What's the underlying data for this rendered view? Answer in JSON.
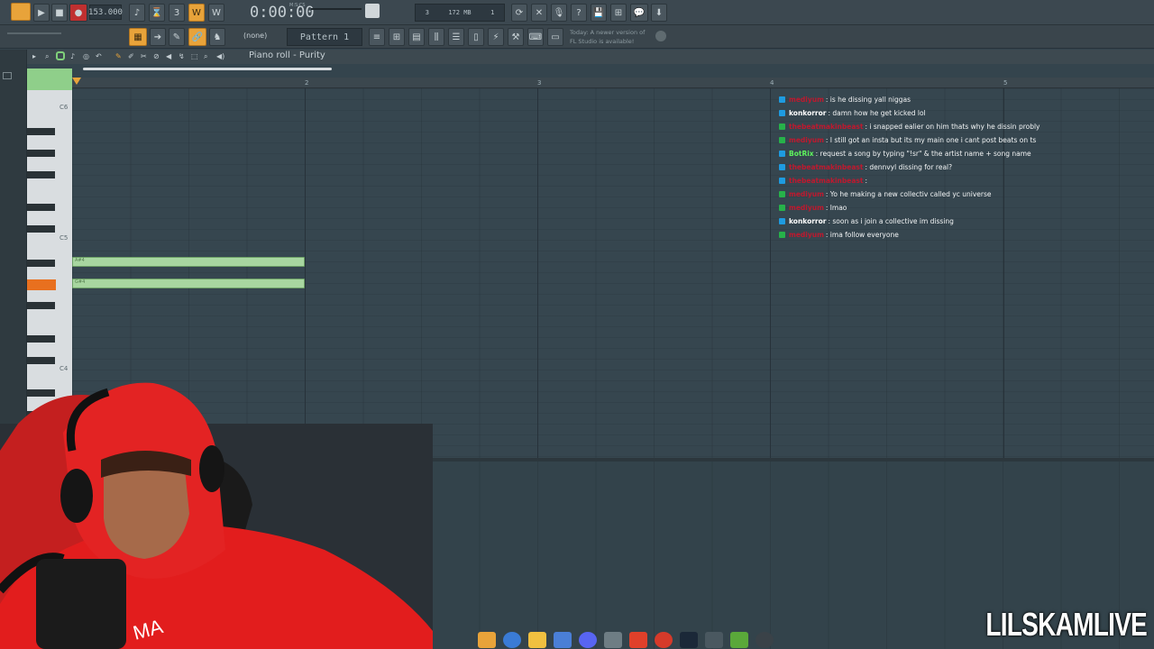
{
  "toolbar": {
    "tempo": "153.000",
    "time_display": "0:00:00",
    "time_mode": "M:S:CS",
    "cpu_bar": "3",
    "memory": "172 MB",
    "voices": "1",
    "pattern_selector": "(none)",
    "pattern_name": "Pattern 1",
    "news_line1": "Today: A newer version of",
    "news_line2": "FL Studio is available!"
  },
  "piano_roll": {
    "title": "Piano roll - Purity",
    "bar_numbers": [
      "2",
      "3",
      "4",
      "5"
    ],
    "octave_labels": [
      "C6",
      "C5",
      "C4"
    ],
    "notes": [
      {
        "label": "A#4"
      },
      {
        "label": "G#4"
      }
    ]
  },
  "chat": {
    "messages": [
      {
        "user": "mediyum",
        "user_color": "#c0182e",
        "text": ": is he dissing yall niggas",
        "badge": "blue"
      },
      {
        "user": "konkorror",
        "user_color": "#ffffff",
        "text": ": damn how he get kicked lol",
        "badge": "blue"
      },
      {
        "user": "thebeatmakinbeast",
        "user_color": "#c0182e",
        "text": ": i snapped ealier on him thats why he dissin probly",
        "badge": "green"
      },
      {
        "user": "mediyum",
        "user_color": "#c0182e",
        "text": ": I still got an insta but its my main one i cant post beats on ts",
        "badge": "green"
      },
      {
        "user": "BotRix",
        "user_color": "#5ef25e",
        "text": ": request a song by typing \"!sr\" & the artist name + song name",
        "badge": "blue"
      },
      {
        "user": "thebeatmakinbeast",
        "user_color": "#c0182e",
        "text": ": dennvyl dissing for real?",
        "badge": "blue"
      },
      {
        "user": "thebeatmakinbeast",
        "user_color": "#c0182e",
        "text": ": ",
        "badge": "blue"
      },
      {
        "user": "mediyum",
        "user_color": "#c0182e",
        "text": ": Yo he making a new collectiv called yc universe",
        "badge": "green"
      },
      {
        "user": "mediyum",
        "user_color": "#c0182e",
        "text": ": lmao",
        "badge": "green"
      },
      {
        "user": "konkorror",
        "user_color": "#ffffff",
        "text": ": soon as i join a collective im dissing",
        "badge": "blue"
      },
      {
        "user": "mediyum",
        "user_color": "#c0182e",
        "text": ": ima follow everyone",
        "badge": "green"
      }
    ]
  },
  "watermark": "LILSKAMLIVE",
  "colors": {
    "accent": "#e8a33a",
    "note": "#a8d6a0",
    "grid": "#36464f",
    "key_highlight": "#e8701f"
  }
}
